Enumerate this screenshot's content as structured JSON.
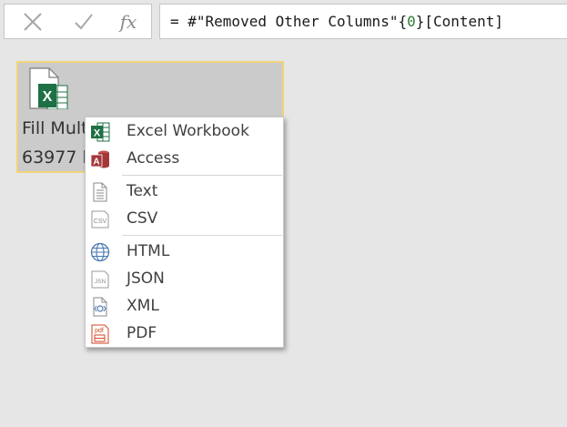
{
  "formula_bar": {
    "cancel_icon": "x-icon",
    "confirm_icon": "checkmark-icon",
    "function_label": "fx",
    "formula_prefix": "= #\"Removed Other Columns\"{",
    "formula_index": "0",
    "formula_suffix": "}[Content]"
  },
  "file_tile": {
    "icon": "excel-file-icon",
    "name": "Fill Mult",
    "size": "63977 b"
  },
  "context_menu": {
    "items": [
      {
        "label": "Excel Workbook",
        "icon": "excel-icon"
      },
      {
        "label": "Access",
        "icon": "access-icon"
      },
      {
        "label": "Text",
        "icon": "text-file-icon"
      },
      {
        "label": "CSV",
        "icon": "csv-file-icon"
      },
      {
        "label": "HTML",
        "icon": "globe-icon"
      },
      {
        "label": "JSON",
        "icon": "json-file-icon"
      },
      {
        "label": "XML",
        "icon": "xml-file-icon"
      },
      {
        "label": "PDF",
        "icon": "pdf-file-icon"
      }
    ]
  },
  "colors": {
    "background": "#e6e6e6",
    "tile_background": "#cbcbcb",
    "tile_border": "#f2d27a",
    "excel_green": "#1e7145",
    "access_red": "#a4373a",
    "pdf_red": "#d24726"
  }
}
